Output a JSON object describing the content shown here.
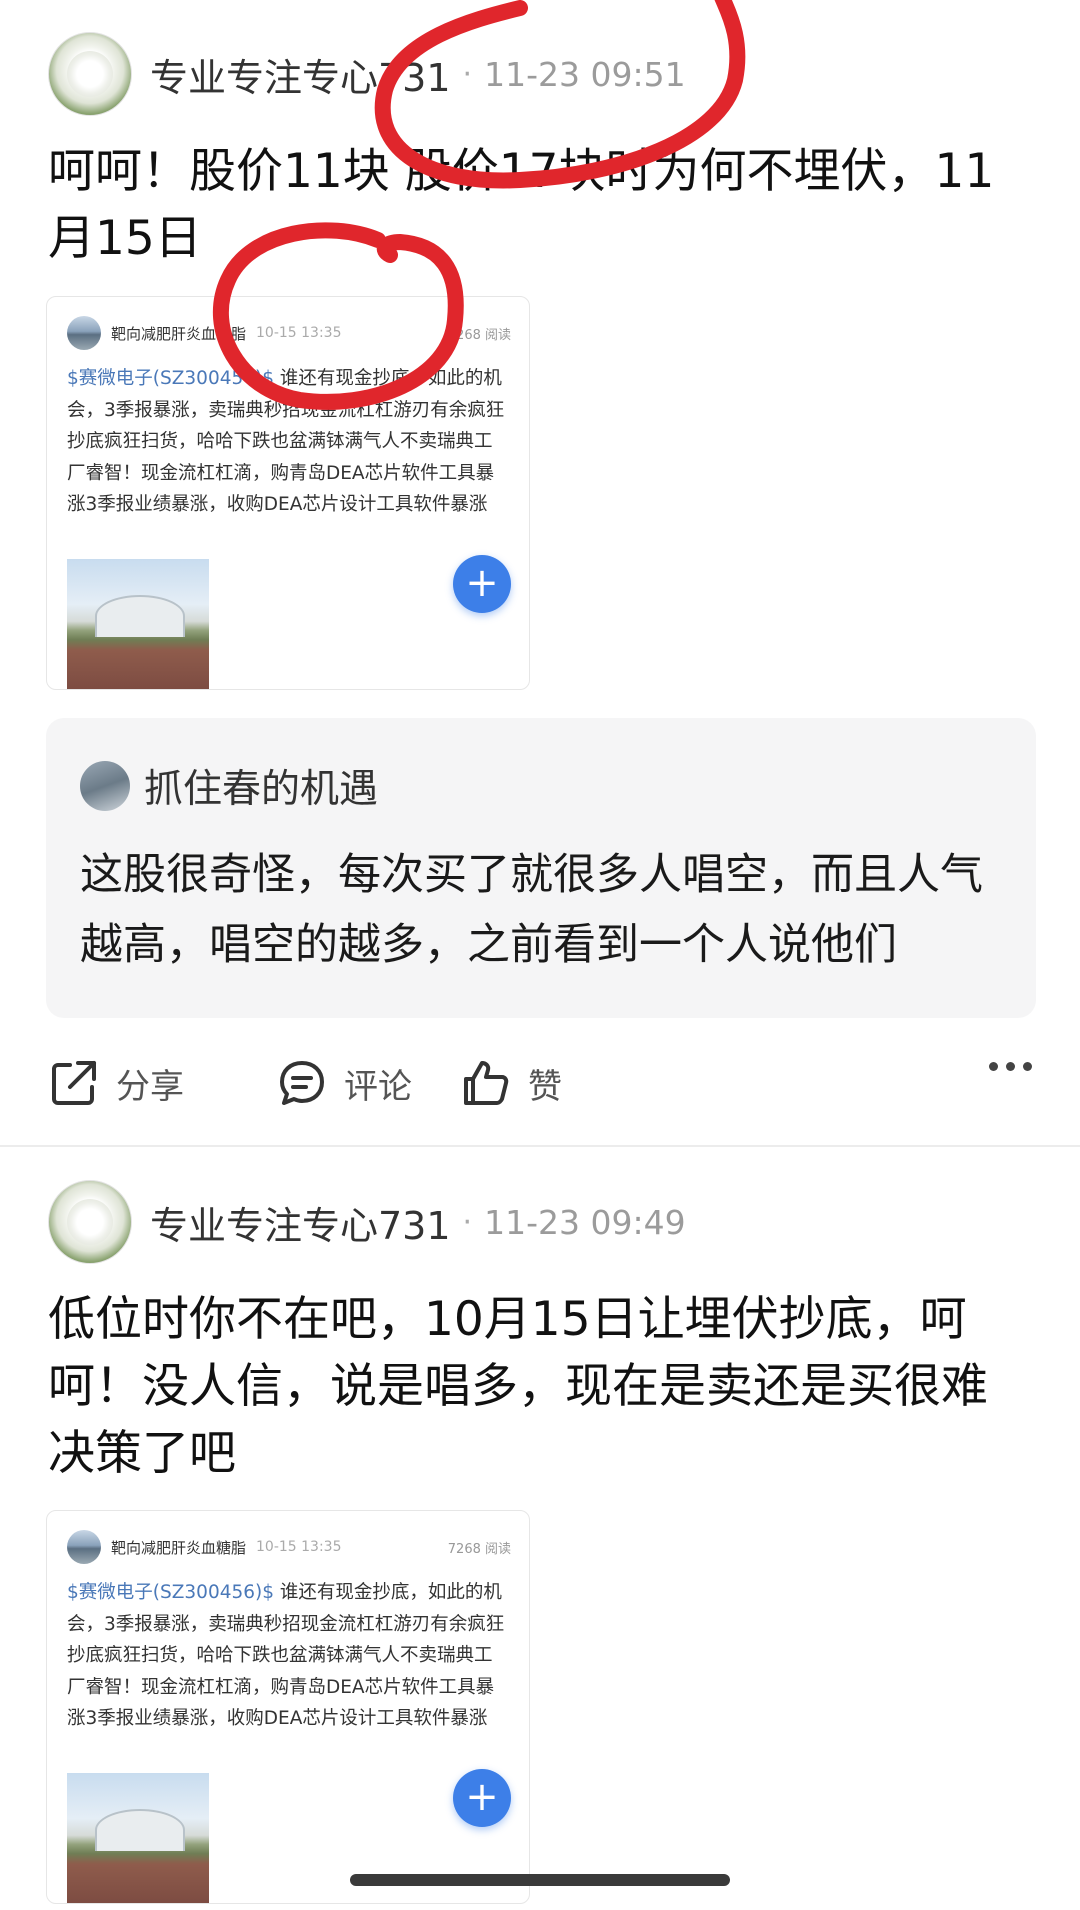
{
  "posts": [
    {
      "author": "专业专注专心731",
      "time": "11-23 09:51",
      "text": "呵呵！股价11块 股价17块时为何不埋伏，11月15日",
      "share": {
        "author": "靶向减肥肝炎血糖脂",
        "time": "10-15 13:35",
        "views": "7268 阅读",
        "tag": "$赛微电子(SZ300456)$",
        "body": " 谁还有现金抄底，如此的机会，3季报暴涨，卖瑞典秒招现金流杠杠游刃有余疯狂抄底疯狂扫货，哈哈下跌也盆满钵满气人不卖瑞典工厂睿智！现金流杠杠滴，购青岛DEA芯片软件工具暴涨3季报业绩暴涨，收购DEA芯片设计工具软件暴涨OSC光开关暴涨开始入场扫货，…"
      },
      "comment": {
        "author": "抓住春的机遇",
        "text": "这股很奇怪，每次买了就很多人唱空，而且人气越高，唱空的越多，之前看到一个人说他们"
      },
      "actions": {
        "share": "分享",
        "comment": "评论",
        "like": "赞"
      }
    },
    {
      "author": "专业专注专心731",
      "time": "11-23 09:49",
      "text": "低位时你不在吧，10月15日让埋伏抄底，呵呵！没人信，说是唱多，现在是卖还是买很难决策了吧",
      "share": {
        "author": "靶向减肥肝炎血糖脂",
        "time": "10-15 13:35",
        "views": "7268 阅读",
        "tag": "$赛微电子(SZ300456)$",
        "body": " 谁还有现金抄底，如此的机会，3季报暴涨，卖瑞典秒招现金流杠杠游刃有余疯狂抄底疯狂扫货，哈哈下跌也盆满钵满气人不卖瑞典工厂睿智！现金流杠杠滴，购青岛DEA芯片软件工具暴涨3季报业绩暴涨，收购DEA芯片设计工具软件暴涨OSC光开关暴涨开始入场扫货，…"
      }
    }
  ],
  "separator": "·",
  "colors": {
    "annotation": "#e0262c",
    "link": "#4a78b8",
    "fab": "#3d7fe8"
  }
}
